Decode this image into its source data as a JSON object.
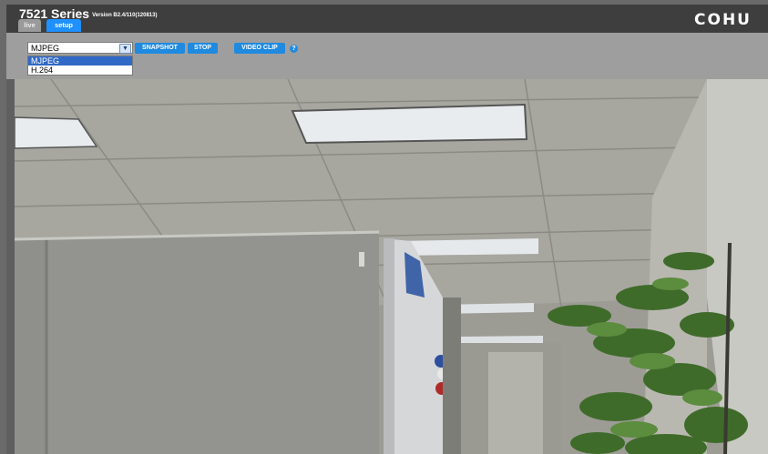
{
  "header": {
    "title": "7521 Series",
    "version": "Version B2.4/110(120813)",
    "logo": "COHU",
    "tabs": [
      {
        "label": "live",
        "active": true
      },
      {
        "label": "setup",
        "active": false
      }
    ]
  },
  "toolbar": {
    "stream_select": {
      "value": "MJPEG",
      "options": [
        "MJPEG",
        "H.264"
      ],
      "highlighted": "MJPEG"
    },
    "snapshot_label": "SNAPSHOT",
    "stop_label": "STOP",
    "video_clip_label": "VIDEO CLIP",
    "help_label": "?"
  },
  "video": {
    "description_icon": "camera-live-feed"
  },
  "colors": {
    "header_bg": "#3e3e3e",
    "toolbar_bg": "#9e9e9e",
    "accent_blue": "#1f8ae0",
    "selection_blue": "#3169c6"
  }
}
